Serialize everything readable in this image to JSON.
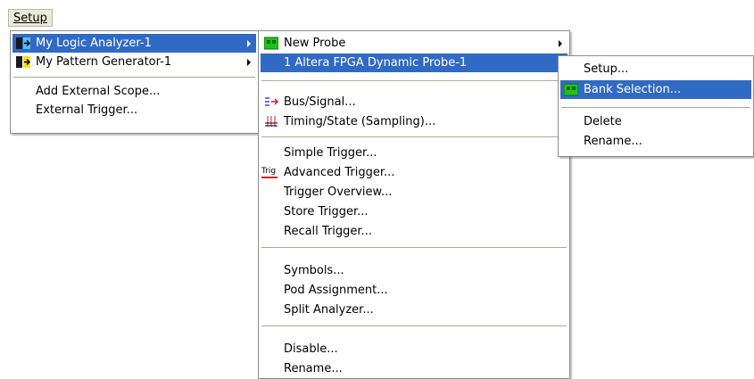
{
  "menubar": {
    "setup": "Setup"
  },
  "menu1": {
    "items": [
      {
        "label": "My Logic Analyzer-1"
      },
      {
        "label": "My Pattern Generator-1"
      },
      {
        "label": "Add External Scope..."
      },
      {
        "label": "External Trigger..."
      }
    ]
  },
  "menu2": {
    "items": [
      {
        "label": "New Probe"
      },
      {
        "label": "1 Altera FPGA Dynamic Probe-1"
      },
      {
        "label": "Bus/Signal..."
      },
      {
        "label": "Timing/State (Sampling)..."
      },
      {
        "label": "Simple Trigger..."
      },
      {
        "label": "Advanced Trigger..."
      },
      {
        "label": "Trigger Overview..."
      },
      {
        "label": "Store Trigger..."
      },
      {
        "label": "Recall Trigger..."
      },
      {
        "label": "Symbols..."
      },
      {
        "label": "Pod Assignment..."
      },
      {
        "label": "Split Analyzer..."
      },
      {
        "label": "Disable..."
      },
      {
        "label": "Rename..."
      }
    ],
    "trig_icon_text": "Trig"
  },
  "menu3": {
    "items": [
      {
        "label": "Setup..."
      },
      {
        "label": "Bank Selection..."
      },
      {
        "label": "Delete"
      },
      {
        "label": "Rename..."
      }
    ]
  },
  "colors": {
    "highlight": "#316ac5",
    "menu_bg": "#ffffff",
    "separator": "#aca899"
  }
}
